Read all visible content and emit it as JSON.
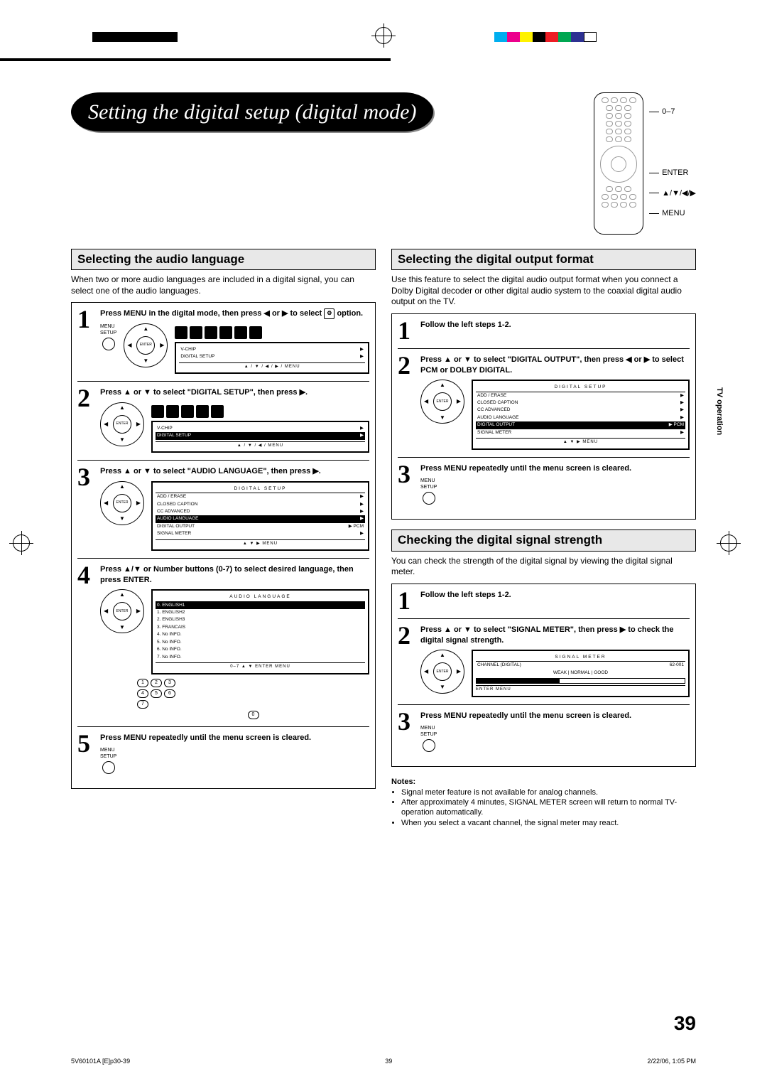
{
  "page_title": "Setting the digital setup (digital mode)",
  "remote_labels": {
    "l1": "0–7",
    "l2": "ENTER",
    "l3": "▲/▼/◀/▶",
    "l4": "MENU"
  },
  "side_tab": "TV operation",
  "page_number": "39",
  "footer": {
    "left": "5V60101A [E]p30-39",
    "center": "39",
    "right": "2/22/06, 1:05 PM"
  },
  "left": {
    "heading": "Selecting the audio language",
    "intro": "When two or more audio languages are included in a digital signal, you can select one of the audio languages.",
    "steps": {
      "s1a": "Press MENU in the digital mode, then press ◀ or ▶ to select ",
      "s1b": " option.",
      "s2": "Press ▲ or ▼ to select \"DIGITAL SETUP\", then press ▶.",
      "s3": "Press ▲ or ▼ to select \"AUDIO LANGUAGE\", then press ▶.",
      "s4": "Press ▲/▼ or Number buttons (0-7) to select desired language, then press ENTER.",
      "s5": "Press MENU repeatedly until the menu screen is cleared."
    },
    "osd1": {
      "r1": "V-CHIP",
      "r2": "DIGITAL SETUP",
      "foot": "▲ / ▼ / ◀ / ▶ / MENU"
    },
    "osd2": {
      "r1": "V-CHIP",
      "r2": "DIGITAL SETUP",
      "foot": "▲ / ▼ / ◀ / MENU"
    },
    "osd3": {
      "title": "DIGITAL SETUP",
      "rows": [
        "ADD / ERASE",
        "CLOSED CAPTION",
        "CC ADVANCED",
        "AUDIO LANGUAGE",
        "DIGITAL OUTPUT",
        "SIGNAL METER"
      ],
      "val4": "PCM",
      "foot": "▲ ▼ ▶ MENU"
    },
    "osd4": {
      "title": "AUDIO LANGUAGE",
      "rows": [
        "0. ENGLISH1",
        "1. ENGLISH2",
        "2. ENGLISH3",
        "3. FRANCAIS",
        "4. No INFO.",
        "5. No INFO.",
        "6. No INFO.",
        "7. No INFO."
      ],
      "foot": "0–7 ▲ ▼ ENTER MENU"
    },
    "menu_label": "MENU\nSETUP"
  },
  "right": {
    "sec1": {
      "heading": "Selecting the digital output format",
      "intro": "Use this feature to select the digital audio output format when you connect a Dolby Digital decoder or other digital audio system to the coaxial digital audio output on the TV.",
      "s1": "Follow the left steps 1-2.",
      "s2": "Press ▲ or ▼ to select \"DIGITAL OUTPUT\", then press ◀ or ▶ to select PCM or DOLBY DIGITAL.",
      "s3": "Press MENU repeatedly until the menu screen is cleared.",
      "osd": {
        "title": "DIGITAL SETUP",
        "rows": [
          "ADD / ERASE",
          "CLOSED CAPTION",
          "CC ADVANCED",
          "AUDIO LANGUAGE",
          "DIGITAL OUTPUT",
          "SIGNAL METER"
        ],
        "val4": "PCM",
        "foot": "▲ ▼ ▶ MENU"
      }
    },
    "sec2": {
      "heading": "Checking the digital signal strength",
      "intro": "You can check the strength of the digital signal by viewing the digital signal meter.",
      "s1": "Follow the left steps 1-2.",
      "s2": "Press ▲ or ▼ to select \"SIGNAL METER\", then press ▶ to check the digital signal strength.",
      "s3": "Press MENU repeatedly until the menu screen is cleared.",
      "osd": {
        "title": "SIGNAL METER",
        "ch_label": "CHANNEL (DIGITAL)",
        "ch_val": "62-001",
        "scale": "WEAK  |  NORMAL  |  GOOD",
        "foot": "ENTER MENU"
      }
    },
    "notes_title": "Notes:",
    "notes": [
      "Signal meter feature is not available for analog channels.",
      "After approximately 4 minutes, SIGNAL METER screen will return to normal TV-operation automatically.",
      "When you select a vacant channel, the signal meter may react."
    ]
  }
}
